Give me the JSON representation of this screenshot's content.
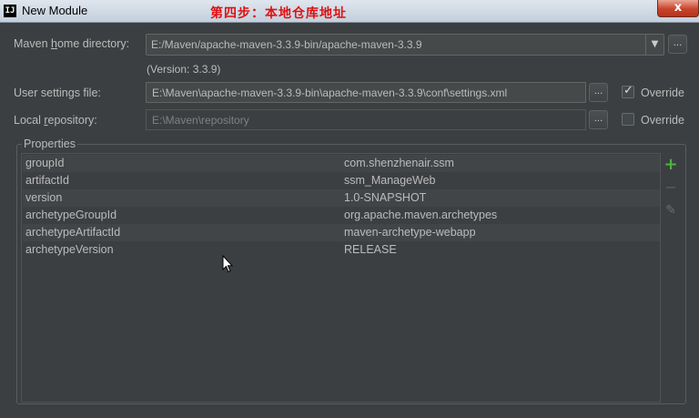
{
  "window": {
    "title": "New Module",
    "annotation": "第四步：本地仓库地址",
    "close_label": "x"
  },
  "form": {
    "maven_home": {
      "label_prefix": "Maven ",
      "label_mnemonic": "h",
      "label_suffix": "ome directory:",
      "value": "E:/Maven/apache-maven-3.3.9-bin/apache-maven-3.3.9",
      "version": "(Version: 3.3.9)"
    },
    "user_settings": {
      "label": "User settings file:",
      "value": "E:\\Maven\\apache-maven-3.3.9-bin\\apache-maven-3.3.9\\conf\\settings.xml",
      "override_label": "Override",
      "override_checked": true
    },
    "local_repository": {
      "label_prefix": "Local ",
      "label_mnemonic": "r",
      "label_suffix": "epository:",
      "value": "E:\\Maven\\repository",
      "override_label": "Override",
      "override_checked": false
    },
    "browse_label": "..."
  },
  "properties": {
    "title": "Properties",
    "rows": [
      {
        "key": "groupId",
        "value": "com.shenzhenair.ssm"
      },
      {
        "key": "artifactId",
        "value": "ssm_ManageWeb"
      },
      {
        "key": "version",
        "value": "1.0-SNAPSHOT"
      },
      {
        "key": "archetypeGroupId",
        "value": "org.apache.maven.archetypes"
      },
      {
        "key": "archetypeArtifactId",
        "value": "maven-archetype-webapp"
      },
      {
        "key": "archetypeVersion",
        "value": "RELEASE"
      }
    ],
    "tools": {
      "add_icon": "+",
      "remove_icon": "−",
      "edit_icon": "✎"
    }
  },
  "colors": {
    "background": "#3c3f41",
    "annotation": "#e01010",
    "add_green": "#4fb342"
  }
}
